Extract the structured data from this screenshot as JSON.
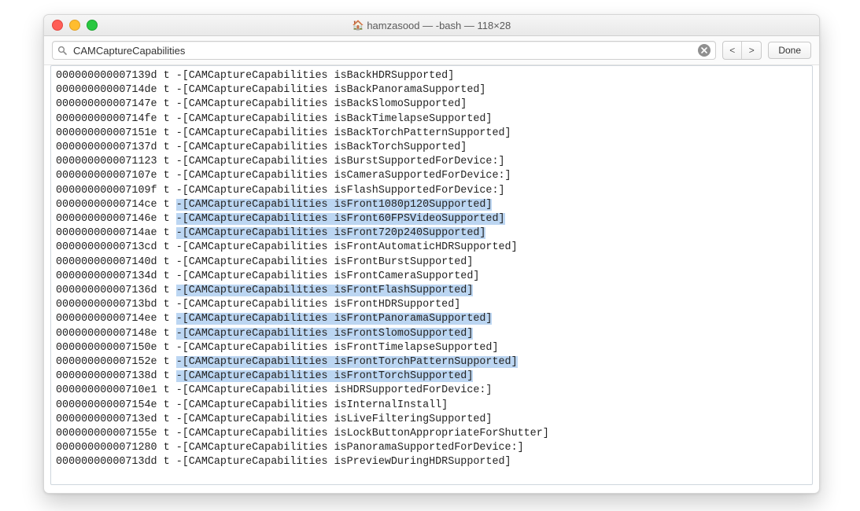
{
  "titlebar": {
    "home_icon": "🏠",
    "title": "hamzasood — -bash — 118×28"
  },
  "findbar": {
    "search_value": "CAMCaptureCapabilities",
    "prev_label": "<",
    "next_label": ">",
    "done_label": "Done"
  },
  "terminal": {
    "lines": [
      {
        "addr": "000000000007139d",
        "flag": "t",
        "cls": "CAMCaptureCapabilities",
        "method": "isBackHDRSupported",
        "hl": false
      },
      {
        "addr": "00000000000714de",
        "flag": "t",
        "cls": "CAMCaptureCapabilities",
        "method": "isBackPanoramaSupported",
        "hl": false
      },
      {
        "addr": "000000000007147e",
        "flag": "t",
        "cls": "CAMCaptureCapabilities",
        "method": "isBackSlomoSupported",
        "hl": false
      },
      {
        "addr": "00000000000714fe",
        "flag": "t",
        "cls": "CAMCaptureCapabilities",
        "method": "isBackTimelapseSupported",
        "hl": false
      },
      {
        "addr": "000000000007151e",
        "flag": "t",
        "cls": "CAMCaptureCapabilities",
        "method": "isBackTorchPatternSupported",
        "hl": false
      },
      {
        "addr": "000000000007137d",
        "flag": "t",
        "cls": "CAMCaptureCapabilities",
        "method": "isBackTorchSupported",
        "hl": false
      },
      {
        "addr": "0000000000071123",
        "flag": "t",
        "cls": "CAMCaptureCapabilities",
        "method": "isBurstSupportedForDevice:",
        "hl": false
      },
      {
        "addr": "000000000007107e",
        "flag": "t",
        "cls": "CAMCaptureCapabilities",
        "method": "isCameraSupportedForDevice:",
        "hl": false
      },
      {
        "addr": "000000000007109f",
        "flag": "t",
        "cls": "CAMCaptureCapabilities",
        "method": "isFlashSupportedForDevice:",
        "hl": false
      },
      {
        "addr": "00000000000714ce",
        "flag": "t",
        "cls": "CAMCaptureCapabilities",
        "method": "isFront1080p120Supported",
        "hl": true
      },
      {
        "addr": "000000000007146e",
        "flag": "t",
        "cls": "CAMCaptureCapabilities",
        "method": "isFront60FPSVideoSupported",
        "hl": true
      },
      {
        "addr": "00000000000714ae",
        "flag": "t",
        "cls": "CAMCaptureCapabilities",
        "method": "isFront720p240Supported",
        "hl": true
      },
      {
        "addr": "00000000000713cd",
        "flag": "t",
        "cls": "CAMCaptureCapabilities",
        "method": "isFrontAutomaticHDRSupported",
        "hl": false
      },
      {
        "addr": "000000000007140d",
        "flag": "t",
        "cls": "CAMCaptureCapabilities",
        "method": "isFrontBurstSupported",
        "hl": false
      },
      {
        "addr": "000000000007134d",
        "flag": "t",
        "cls": "CAMCaptureCapabilities",
        "method": "isFrontCameraSupported",
        "hl": false
      },
      {
        "addr": "000000000007136d",
        "flag": "t",
        "cls": "CAMCaptureCapabilities",
        "method": "isFrontFlashSupported",
        "hl": true
      },
      {
        "addr": "00000000000713bd",
        "flag": "t",
        "cls": "CAMCaptureCapabilities",
        "method": "isFrontHDRSupported",
        "hl": false
      },
      {
        "addr": "00000000000714ee",
        "flag": "t",
        "cls": "CAMCaptureCapabilities",
        "method": "isFrontPanoramaSupported",
        "hl": true
      },
      {
        "addr": "000000000007148e",
        "flag": "t",
        "cls": "CAMCaptureCapabilities",
        "method": "isFrontSlomoSupported",
        "hl": true
      },
      {
        "addr": "000000000007150e",
        "flag": "t",
        "cls": "CAMCaptureCapabilities",
        "method": "isFrontTimelapseSupported",
        "hl": false
      },
      {
        "addr": "000000000007152e",
        "flag": "t",
        "cls": "CAMCaptureCapabilities",
        "method": "isFrontTorchPatternSupported",
        "hl": true
      },
      {
        "addr": "000000000007138d",
        "flag": "t",
        "cls": "CAMCaptureCapabilities",
        "method": "isFrontTorchSupported",
        "hl": true
      },
      {
        "addr": "00000000000710e1",
        "flag": "t",
        "cls": "CAMCaptureCapabilities",
        "method": "isHDRSupportedForDevice:",
        "hl": false
      },
      {
        "addr": "000000000007154e",
        "flag": "t",
        "cls": "CAMCaptureCapabilities",
        "method": "isInternalInstall",
        "hl": false
      },
      {
        "addr": "00000000000713ed",
        "flag": "t",
        "cls": "CAMCaptureCapabilities",
        "method": "isLiveFilteringSupported",
        "hl": false
      },
      {
        "addr": "000000000007155e",
        "flag": "t",
        "cls": "CAMCaptureCapabilities",
        "method": "isLockButtonAppropriateForShutter",
        "hl": false
      },
      {
        "addr": "0000000000071280",
        "flag": "t",
        "cls": "CAMCaptureCapabilities",
        "method": "isPanoramaSupportedForDevice:",
        "hl": false
      },
      {
        "addr": "00000000000713dd",
        "flag": "t",
        "cls": "CAMCaptureCapabilities",
        "method": "isPreviewDuringHDRSupported",
        "hl": false
      }
    ]
  }
}
